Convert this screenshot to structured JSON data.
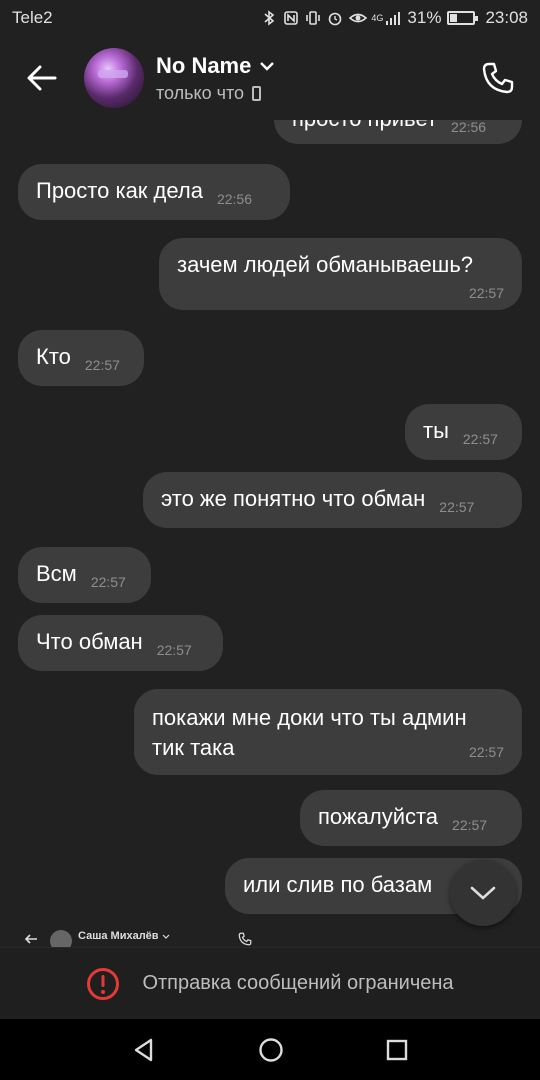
{
  "status_bar": {
    "carrier": "Tele2",
    "network": "4G",
    "battery_percent": "31%",
    "battery_level": 0.31,
    "time": "23:08"
  },
  "header": {
    "name": "No Name",
    "status": "только что"
  },
  "messages": [
    {
      "text": "просто привет",
      "time": "22:56",
      "side": "right"
    },
    {
      "text": "Просто как дела",
      "time": "22:56",
      "side": "left"
    },
    {
      "text": "зачем людей обманываешь?",
      "time": "22:57",
      "side": "right"
    },
    {
      "text": "Кто",
      "time": "22:57",
      "side": "left"
    },
    {
      "text": "ты",
      "time": "22:57",
      "side": "right"
    },
    {
      "text": "это же понятно что обман",
      "time": "22:57",
      "side": "right"
    },
    {
      "text": "Всм",
      "time": "22:57",
      "side": "left"
    },
    {
      "text": "Что обман",
      "time": "22:57",
      "side": "left"
    },
    {
      "text_line1": "покажи мне доки что ты админ",
      "text_line2": "тик така",
      "time": "22:57",
      "side": "right"
    },
    {
      "text": "пожалуйста",
      "time": "22:57",
      "side": "right"
    },
    {
      "text": "или слив по базам",
      "side": "right"
    }
  ],
  "thumbnail": {
    "name": "Саша Михалёв"
  },
  "restricted": {
    "text": "Отправка сообщений ограничена"
  },
  "colors": {
    "background": "#212121",
    "bubble": "#3d3d3d",
    "alert": "#e53935"
  }
}
